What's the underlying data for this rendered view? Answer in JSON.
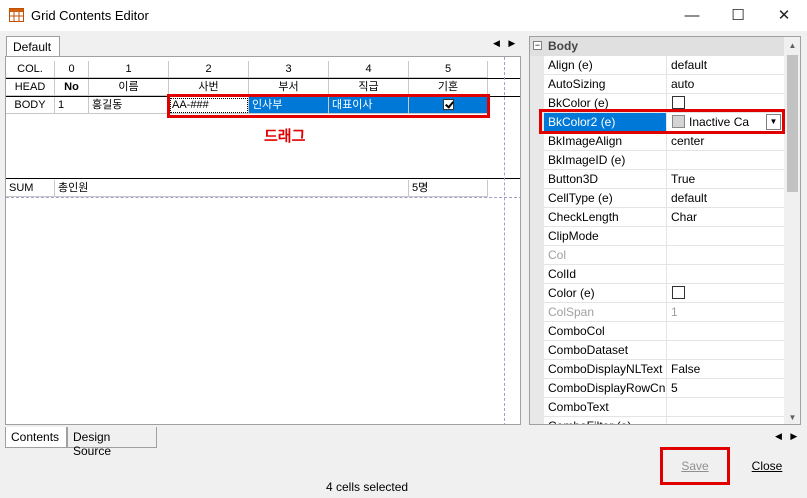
{
  "window": {
    "title": "Grid Contents Editor",
    "minimize": "—",
    "maximize": "☐",
    "close": "✕"
  },
  "top_tabs": {
    "default": "Default",
    "arrows": "◀ ▶"
  },
  "grid": {
    "col_row": [
      "COL.",
      "0",
      "1",
      "2",
      "3",
      "4",
      "5"
    ],
    "head_row": [
      "HEAD",
      "No",
      "이름",
      "사번",
      "부서",
      "직급",
      "기혼"
    ],
    "body_row": [
      "BODY",
      "1",
      "홍길동",
      "AA-###",
      "인사부",
      "대표이사",
      ""
    ],
    "sum_row": [
      "SUM",
      "총인원",
      "",
      "",
      "",
      "5명",
      ""
    ]
  },
  "annotation": {
    "drag_label": "드래그"
  },
  "properties": {
    "category": "Body",
    "category_toggle": "⊟",
    "rows": [
      {
        "name": "Align (e)",
        "value": "default"
      },
      {
        "name": "AutoSizing",
        "value": "auto"
      },
      {
        "name": "BkColor (e)",
        "value": ""
      },
      {
        "name": "BkColor2 (e)",
        "value": "Inactive Ca"
      },
      {
        "name": "BkImageAlign",
        "value": "center"
      },
      {
        "name": "BkImageID (e)",
        "value": ""
      },
      {
        "name": "Button3D",
        "value": "True"
      },
      {
        "name": "CellType (e)",
        "value": "default"
      },
      {
        "name": "CheckLength",
        "value": "Char"
      },
      {
        "name": "ClipMode",
        "value": ""
      },
      {
        "name": "Col",
        "value": ""
      },
      {
        "name": "ColId",
        "value": ""
      },
      {
        "name": "Color (e)",
        "value": ""
      },
      {
        "name": "ColSpan",
        "value": "1"
      },
      {
        "name": "ComboCol",
        "value": ""
      },
      {
        "name": "ComboDataset",
        "value": ""
      },
      {
        "name": "ComboDisplayNLText",
        "value": "False"
      },
      {
        "name": "ComboDisplayRowCn",
        "value": "5"
      },
      {
        "name": "ComboText",
        "value": ""
      },
      {
        "name": "ComboFilter (e)",
        "value": ""
      }
    ]
  },
  "bottom_tabs": {
    "contents": "Contents",
    "design_source": "Design Source",
    "arrows": "◀ ▶"
  },
  "buttons": {
    "save": "Save",
    "close": "Close"
  },
  "status": {
    "text": "4 cells selected"
  },
  "colors": {
    "highlight_red": "#e00000",
    "selection_blue": "#0078d7"
  }
}
